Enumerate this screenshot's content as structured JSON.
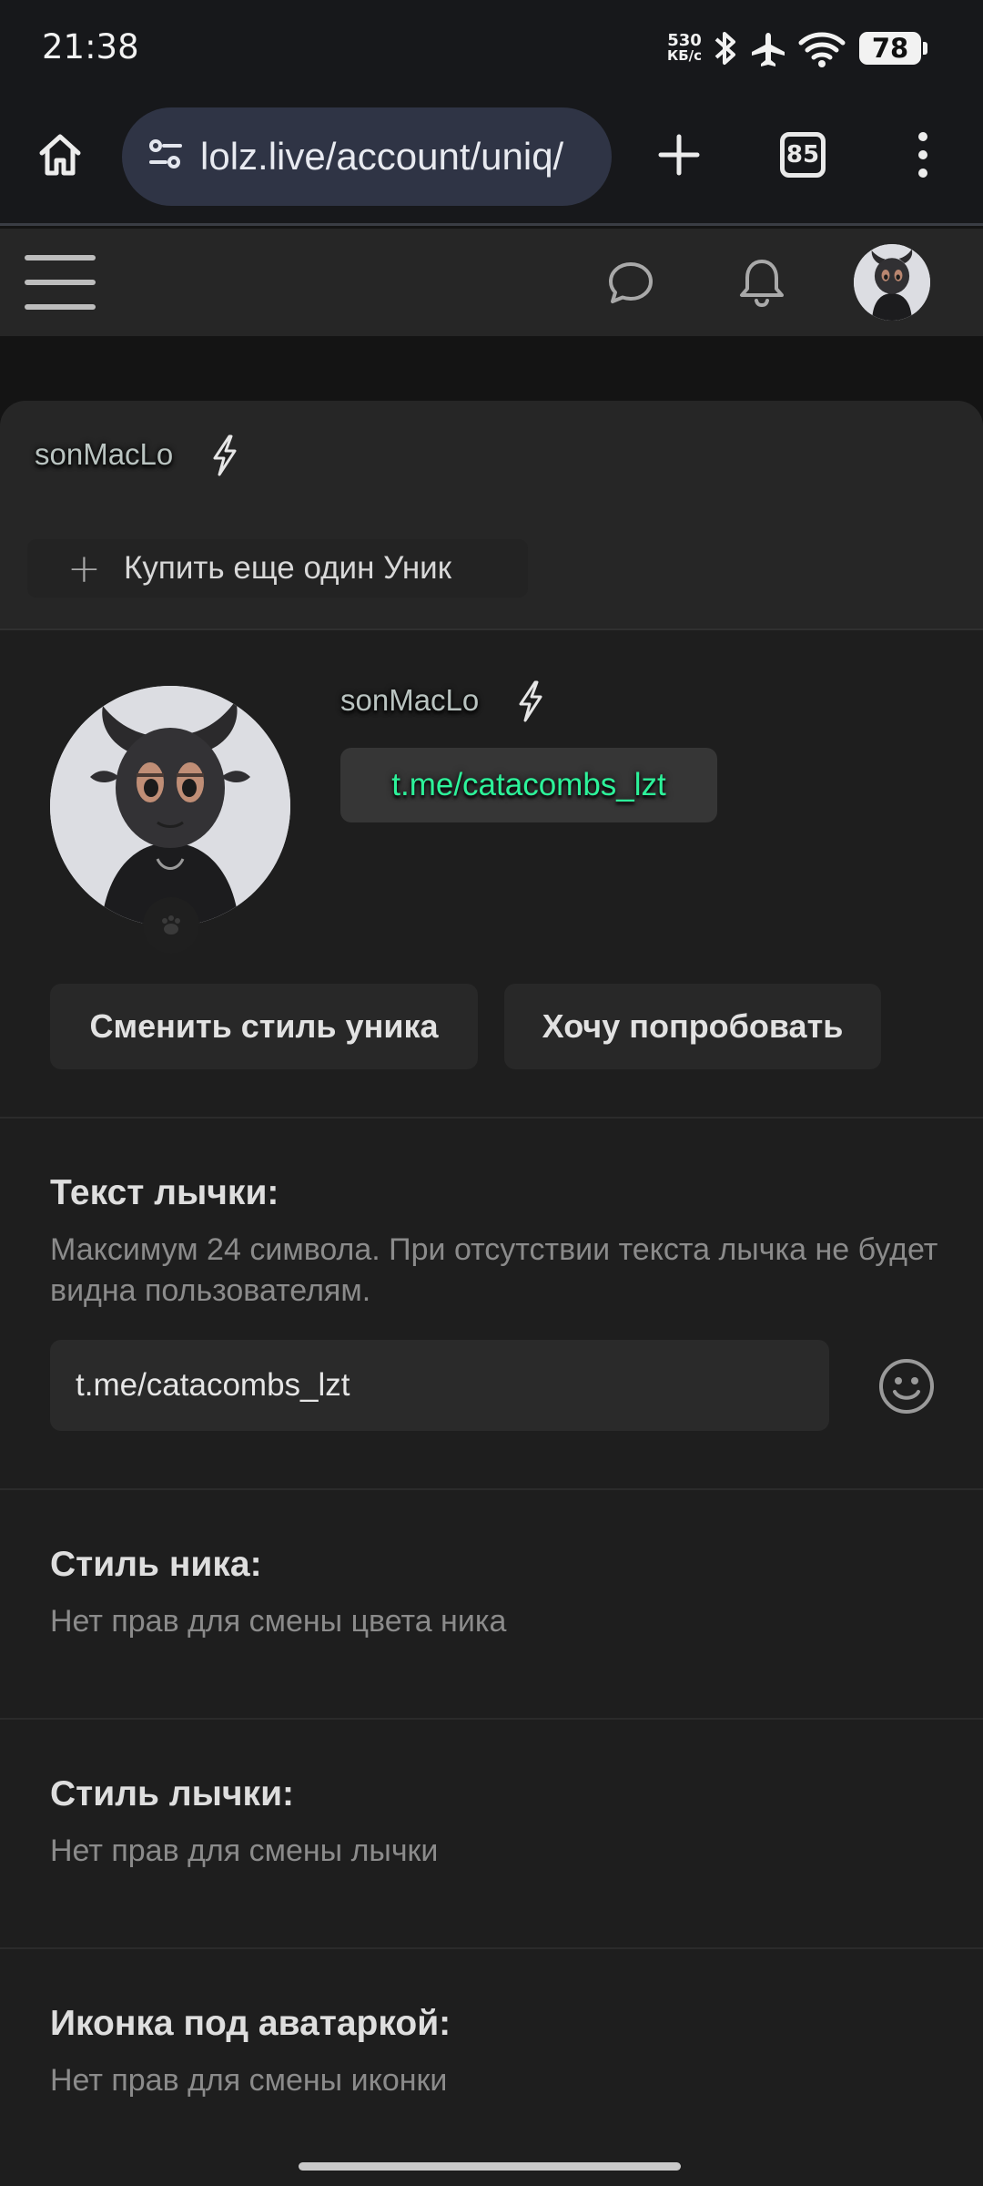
{
  "status_bar": {
    "time": "21:38",
    "net_speed_value": "530",
    "net_speed_unit": "КБ/с",
    "battery": "78",
    "icons": [
      "bluetooth-icon",
      "airplane-icon",
      "wifi-icon",
      "battery-icon"
    ]
  },
  "browser": {
    "url": "lolz.live/account/uniq/",
    "tab_count": "85",
    "icons": [
      "home-icon",
      "site-settings-icon",
      "new-tab-icon",
      "tabs-icon",
      "menu-icon"
    ]
  },
  "site_header": {
    "icons": [
      "hamburger-menu-icon",
      "chat-icon",
      "bell-icon",
      "avatar"
    ]
  },
  "uniq": {
    "top_username": "sonMacLo",
    "buy_button": "Купить еще один Уник",
    "preview_username": "sonMacLo",
    "badge_text": "t.me/catacombs_lzt",
    "badge_color": "#2df29a",
    "change_style_button": "Сменить стиль уника",
    "try_button": "Хочу попробовать"
  },
  "sections": {
    "badge_text_title": "Текст лычки:",
    "badge_text_desc": "Максимум 24 символа. При отсутствии текста лычка не будет видна пользователям.",
    "badge_text_value": "t.me/catacombs_lzt",
    "nick_style_title": "Стиль ника:",
    "nick_style_desc": "Нет прав для смены цвета ника",
    "badge_style_title": "Стиль лычки:",
    "badge_style_desc": "Нет прав для смены лычки",
    "avatar_icon_title": "Иконка под аватаркой:",
    "avatar_icon_desc": "Нет прав для смены иконки"
  }
}
